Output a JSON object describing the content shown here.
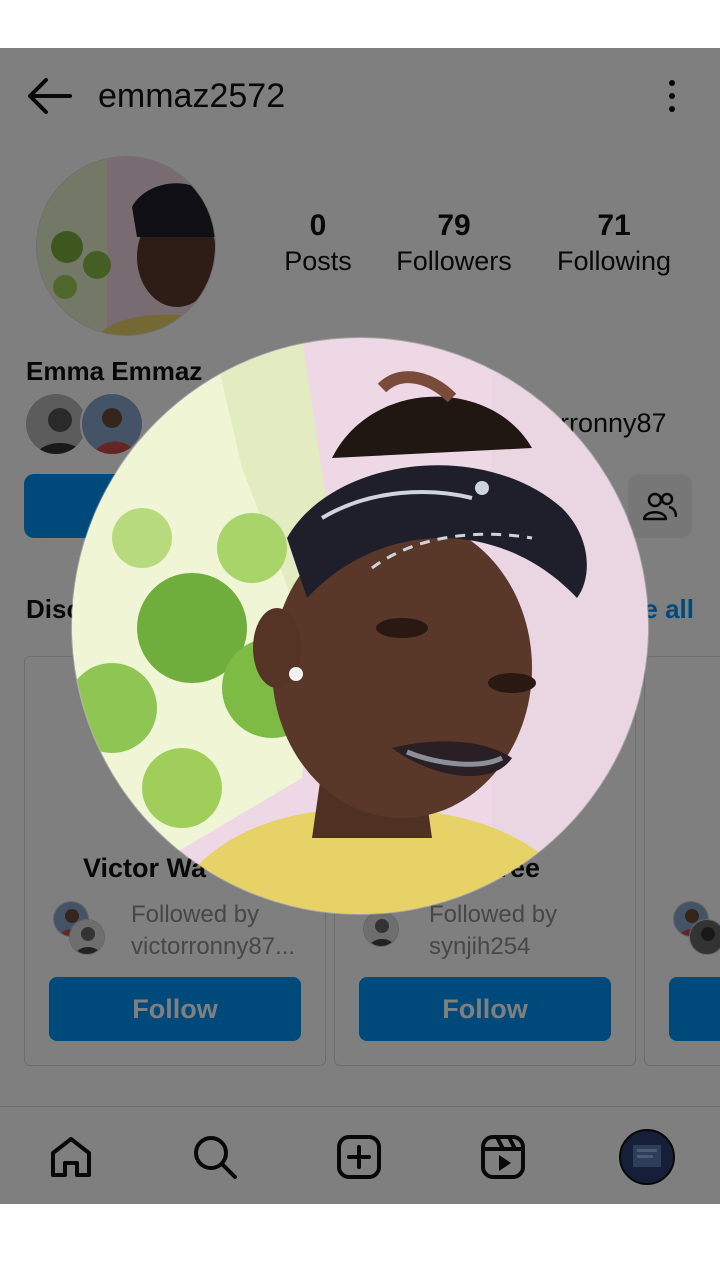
{
  "header": {
    "username": "emmaz2572",
    "back_icon": "arrow-left-icon",
    "menu_icon": "more-vertical-icon"
  },
  "profile": {
    "full_name": "Emma Emmaz",
    "stats": [
      {
        "value": "0",
        "label": "Posts"
      },
      {
        "value": "79",
        "label": "Followers"
      },
      {
        "value": "71",
        "label": "Following"
      }
    ],
    "mutual_text": "rronny87"
  },
  "discover": {
    "label": "Disc",
    "see_all": "e all",
    "cards": [
      {
        "name": "Victor Wa",
        "followed_by": "Followed by",
        "followed_user": "victorronny87...",
        "button": "Follow"
      },
      {
        "name": "vee",
        "followed_by": "Followed by",
        "followed_user": "synjih254",
        "button": "Follow"
      }
    ]
  },
  "nav": {
    "items": [
      "home-icon",
      "search-icon",
      "create-icon",
      "reels-icon",
      "profile-avatar"
    ]
  },
  "colors": {
    "primary": "#0095f6",
    "overlay": "rgba(0,0,0,0.5)"
  }
}
